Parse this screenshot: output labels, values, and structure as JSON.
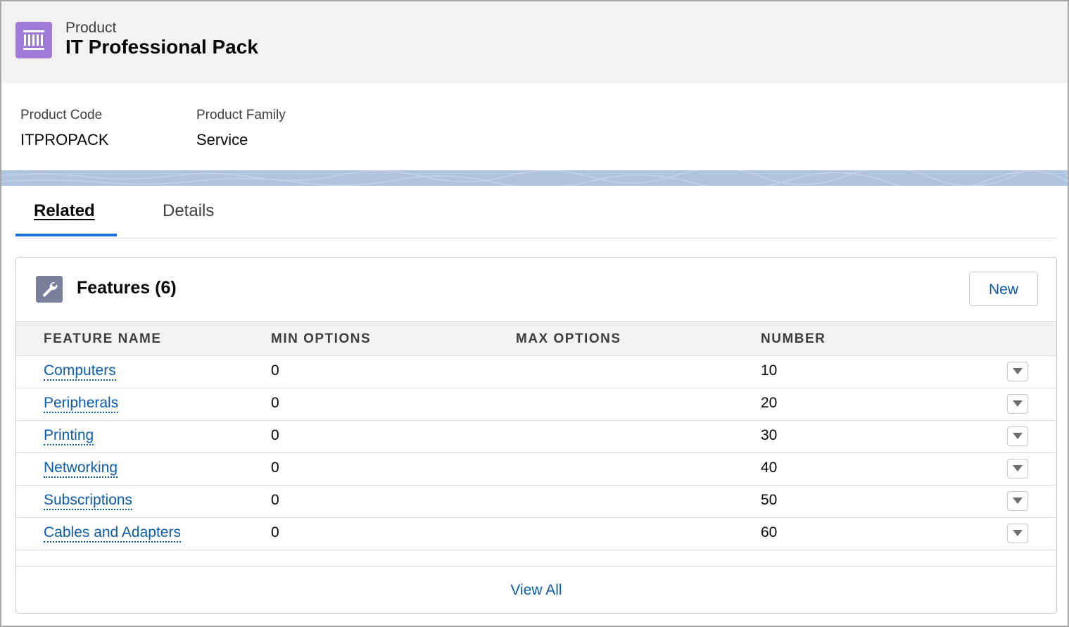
{
  "header": {
    "object_type": "Product",
    "record_name": "IT Professional Pack",
    "icon": "product-barcode-icon",
    "icon_color": "#a07ad7"
  },
  "highlights": {
    "product_code_label": "Product Code",
    "product_code_value": "ITPROPACK",
    "product_family_label": "Product Family",
    "product_family_value": "Service"
  },
  "tabs": [
    {
      "label": "Related",
      "active": true
    },
    {
      "label": "Details",
      "active": false
    }
  ],
  "features_card": {
    "icon": "wrench-icon",
    "title": "Features (6)",
    "new_button": "New",
    "columns": [
      "FEATURE NAME",
      "MIN OPTIONS",
      "MAX OPTIONS",
      "NUMBER"
    ],
    "rows": [
      {
        "name": "Computers",
        "min": "0",
        "max": "",
        "number": "10"
      },
      {
        "name": "Peripherals",
        "min": "0",
        "max": "",
        "number": "20"
      },
      {
        "name": "Printing",
        "min": "0",
        "max": "",
        "number": "30"
      },
      {
        "name": "Networking",
        "min": "0",
        "max": "",
        "number": "40"
      },
      {
        "name": "Subscriptions",
        "min": "0",
        "max": "",
        "number": "50"
      },
      {
        "name": "Cables and Adapters",
        "min": "0",
        "max": "",
        "number": "60"
      }
    ],
    "view_all": "View All"
  },
  "colors": {
    "link": "#0b5cab",
    "active_tab_indicator": "#1b6fd6",
    "header_background": "#f3f2f2",
    "wrench_icon_background": "#7a809c"
  }
}
